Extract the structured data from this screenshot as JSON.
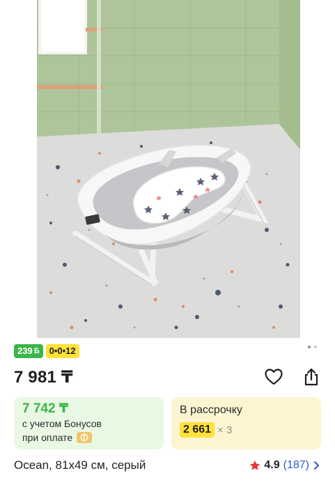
{
  "badges": {
    "bonus": "239",
    "bonus_icon": "Б",
    "installment": "0•0•12"
  },
  "price": {
    "main": "7 981 ₸"
  },
  "bonus_card": {
    "price": "7 742 ₸",
    "line1": "с учетом Бонусов",
    "line2": "при оплате"
  },
  "credit_card": {
    "title": "В рассрочку",
    "amount": "2 661",
    "multiplier": "× 3"
  },
  "product": {
    "title": "Ocean, 81x49 см, серый",
    "rating": "4.9",
    "reviews": "(187)"
  },
  "colors": {
    "accent_green": "#3bb54a",
    "accent_yellow": "#ffe13a",
    "link_blue": "#2a5bd7",
    "star_red": "#e53935"
  },
  "icons": [
    "heart-icon",
    "share-icon",
    "star-icon",
    "chevron-right-icon",
    "fund-icon"
  ]
}
